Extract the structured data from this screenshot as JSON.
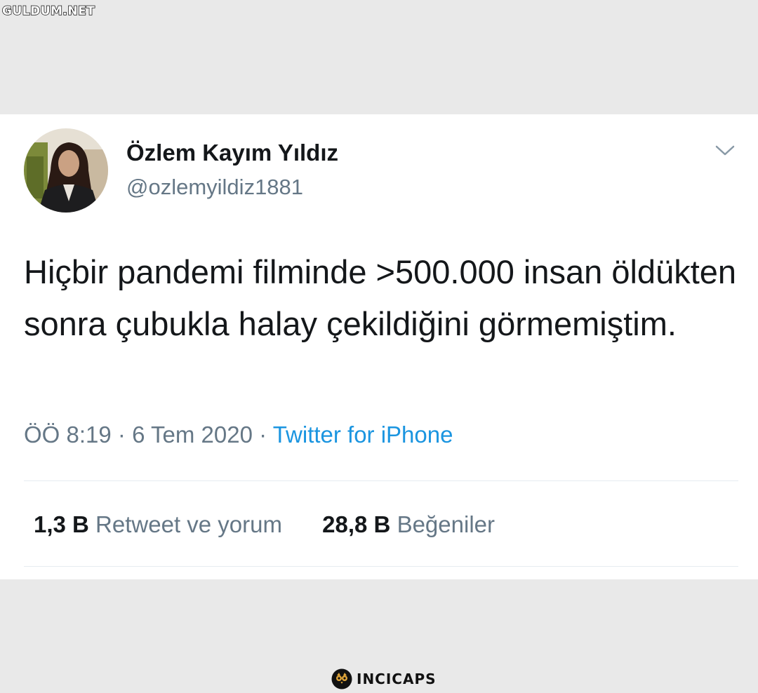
{
  "watermark_top": "GULDUM.NET",
  "tweet": {
    "author_name": "Özlem Kayım Yıldız",
    "author_handle": "@ozlemyildiz1881",
    "text": "Hiçbir pandemi filminde >500.000 insan öldükten sonra çubukla halay çekildiğini görmemiştim.",
    "time": "ÖÖ 8:19",
    "date": "6 Tem 2020",
    "separator": "·",
    "source": "Twitter for iPhone",
    "retweets_count": "1,3 B",
    "retweets_label": "Retweet ve yorum",
    "likes_count": "28,8 B",
    "likes_label": "Beğeniler"
  },
  "watermark_bottom": "INCICAPS",
  "icons": {
    "menu": "chevron-down-icon",
    "brand": "owl-logo-icon"
  },
  "colors": {
    "page_background": "#e9e9e9",
    "card_background": "#ffffff",
    "text_primary": "#14171a",
    "text_secondary": "#657786",
    "link": "#1b95e0"
  }
}
